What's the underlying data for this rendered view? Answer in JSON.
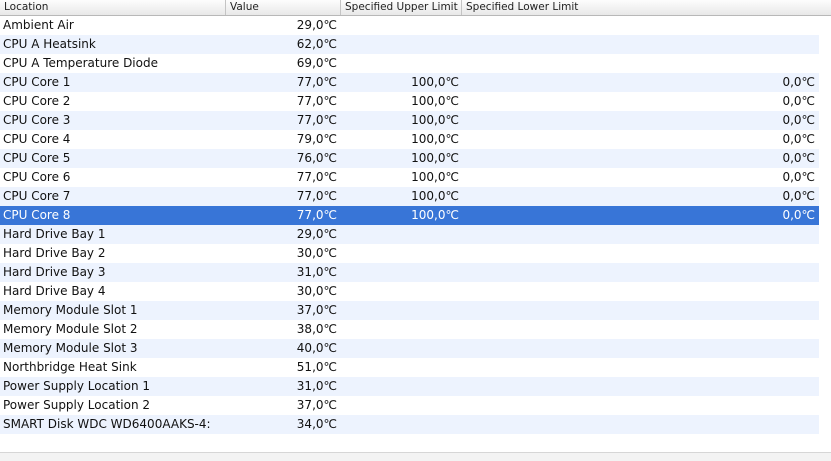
{
  "columns": {
    "location": "Location",
    "value": "Value",
    "upper": "Specified Upper Limit",
    "lower": "Specified Lower Limit"
  },
  "rows": [
    {
      "location": "Ambient Air",
      "value": "29,0℃",
      "upper": "",
      "lower": ""
    },
    {
      "location": "CPU A Heatsink",
      "value": "62,0℃",
      "upper": "",
      "lower": ""
    },
    {
      "location": "CPU A Temperature Diode",
      "value": "69,0℃",
      "upper": "",
      "lower": ""
    },
    {
      "location": "CPU Core 1",
      "value": "77,0℃",
      "upper": "100,0℃",
      "lower": "0,0℃"
    },
    {
      "location": "CPU Core 2",
      "value": "77,0℃",
      "upper": "100,0℃",
      "lower": "0,0℃"
    },
    {
      "location": "CPU Core 3",
      "value": "77,0℃",
      "upper": "100,0℃",
      "lower": "0,0℃"
    },
    {
      "location": "CPU Core 4",
      "value": "79,0℃",
      "upper": "100,0℃",
      "lower": "0,0℃"
    },
    {
      "location": "CPU Core 5",
      "value": "76,0℃",
      "upper": "100,0℃",
      "lower": "0,0℃"
    },
    {
      "location": "CPU Core 6",
      "value": "77,0℃",
      "upper": "100,0℃",
      "lower": "0,0℃"
    },
    {
      "location": "CPU Core 7",
      "value": "77,0℃",
      "upper": "100,0℃",
      "lower": "0,0℃"
    },
    {
      "location": "CPU Core 8",
      "value": "77,0℃",
      "upper": "100,0℃",
      "lower": "0,0℃",
      "selected": true
    },
    {
      "location": "Hard Drive Bay 1",
      "value": "29,0℃",
      "upper": "",
      "lower": ""
    },
    {
      "location": "Hard Drive Bay 2",
      "value": "30,0℃",
      "upper": "",
      "lower": ""
    },
    {
      "location": "Hard Drive Bay 3",
      "value": "31,0℃",
      "upper": "",
      "lower": ""
    },
    {
      "location": "Hard Drive Bay 4",
      "value": "30,0℃",
      "upper": "",
      "lower": ""
    },
    {
      "location": "Memory Module Slot 1",
      "value": "37,0℃",
      "upper": "",
      "lower": ""
    },
    {
      "location": "Memory Module Slot 2",
      "value": "38,0℃",
      "upper": "",
      "lower": ""
    },
    {
      "location": "Memory Module Slot 3",
      "value": "40,0℃",
      "upper": "",
      "lower": ""
    },
    {
      "location": "Northbridge Heat Sink",
      "value": "51,0℃",
      "upper": "",
      "lower": ""
    },
    {
      "location": "Power Supply Location 1",
      "value": "31,0℃",
      "upper": "",
      "lower": ""
    },
    {
      "location": "Power Supply Location 2",
      "value": "37,0℃",
      "upper": "",
      "lower": ""
    },
    {
      "location": "SMART Disk WDC WD6400AAKS-4:",
      "value": "34,0℃",
      "upper": "",
      "lower": ""
    }
  ],
  "colors": {
    "selection": "#3875d7",
    "stripe": "#edf3fe"
  }
}
